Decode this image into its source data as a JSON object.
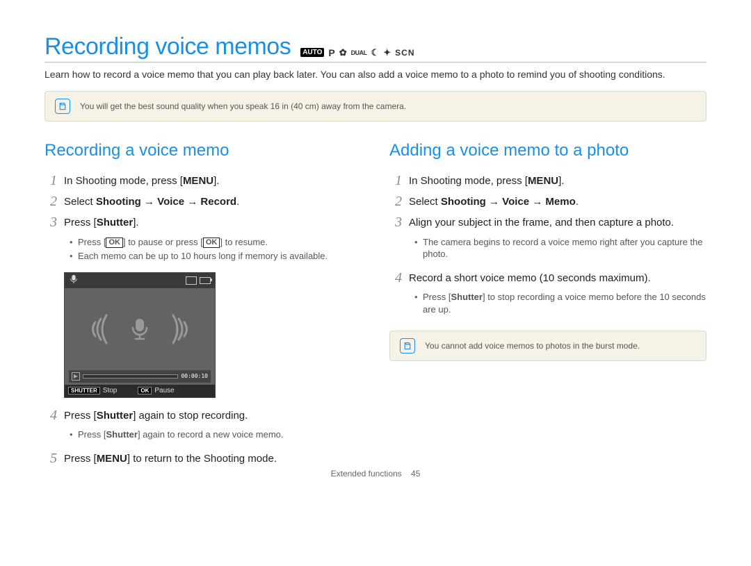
{
  "title": "Recording voice memos",
  "mode_icons": {
    "auto": "AUTO",
    "p": "P",
    "dual": "DUAL",
    "scn": "SCN"
  },
  "intro": "Learn how to record a voice memo that you can play back later. You can also add a voice memo to a photo to remind you of shooting conditions.",
  "note_top": "You will get the best sound quality when you speak 16 in (40 cm) away from the camera.",
  "left": {
    "heading": "Recording a voice memo",
    "step1_pre": "In Shooting mode, press [",
    "step1_kbd": "MENU",
    "step1_post": "].",
    "step2_pre": "Select ",
    "step2_path": "Shooting → Voice → Record",
    "step2_post": ".",
    "step3_pre": "Press [",
    "step3_kbd": "Shutter",
    "step3_post": "].",
    "step3_sub1_pre": "Press [",
    "step3_sub1_kbd1": "OK",
    "step3_sub1_mid": "] to pause or press [",
    "step3_sub1_kbd2": "OK",
    "step3_sub1_post": "] to resume.",
    "step3_sub2": "Each memo can be up to 10 hours long if memory is available.",
    "step4_pre": "Press [",
    "step4_kbd": "Shutter",
    "step4_post": "] again to stop recording.",
    "step4_sub_pre": "Press [",
    "step4_sub_kbd": "Shutter",
    "step4_sub_post": "] again to record a new voice memo.",
    "step5_pre": "Press [",
    "step5_kbd": "MENU",
    "step5_post": "] to return to the Shooting mode."
  },
  "screen": {
    "time": "00:00:10",
    "stop_kbd": "SHUTTER",
    "stop_lbl": "Stop",
    "pause_kbd": "OK",
    "pause_lbl": "Pause"
  },
  "right": {
    "heading": "Adding a voice memo to a photo",
    "step1_pre": "In Shooting mode, press [",
    "step1_kbd": "MENU",
    "step1_post": "].",
    "step2_pre": "Select ",
    "step2_path": "Shooting → Voice → Memo",
    "step2_post": ".",
    "step3": "Align your subject in the frame, and then capture a photo.",
    "step3_sub": "The camera begins to record a voice memo right after you capture the photo.",
    "step4": "Record a short voice memo (10 seconds maximum).",
    "step4_sub_pre": "Press [",
    "step4_sub_kbd": "Shutter",
    "step4_sub_post": "] to stop recording a voice memo before the 10 seconds are up.",
    "note": "You cannot add voice memos to photos in the burst mode."
  },
  "footer_section": "Extended functions",
  "footer_page": "45"
}
